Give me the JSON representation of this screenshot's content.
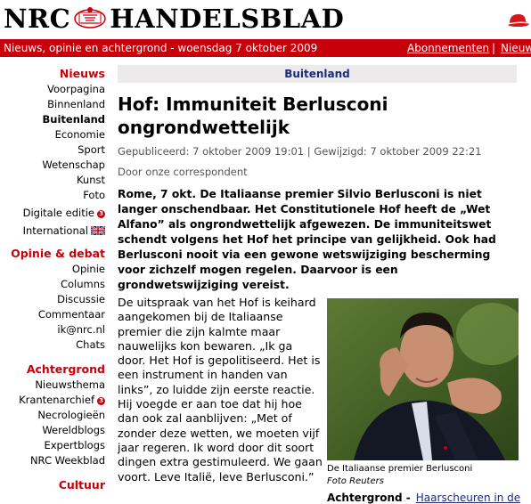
{
  "masthead": {
    "left": "NRC",
    "right": "HANDELSBLAD"
  },
  "topbar": {
    "tagline": "Nieuws, opinie en achtergrond - woensdag 7 oktober 2009",
    "subscribe": "Abonnementen",
    "more": "Nieuw"
  },
  "sidebar": {
    "nieuws_heading": "Nieuws",
    "nieuws_items": [
      "Voorpagina",
      "Binnenland",
      "Buitenland",
      "Economie",
      "Sport",
      "Wetenschap",
      "Kunst",
      "Foto"
    ],
    "digitale": "Digitale editie",
    "international": "International",
    "opinie_heading": "Opinie & debat",
    "opinie_items": [
      "Opinie",
      "Columns",
      "Discussie",
      "Commentaar",
      "ik@nrc.nl",
      "Chats"
    ],
    "achtergrond_heading": "Achtergrond",
    "achtergrond_items": [
      "Nieuwsthema",
      "Krantenarchief",
      "Necrologieën",
      "Wereldblogs",
      "Expertblogs",
      "NRC Weekblad"
    ],
    "cultuur_heading": "Cultuur",
    "badge": "3"
  },
  "article": {
    "section": "Buitenland",
    "title": "Hof: Immuniteit Berlusconi ongrondwettelijk",
    "meta": "Gepubliceerd: 7 oktober 2009 19:01 | Gewijzigd: 7 oktober 2009 22:21",
    "byline": "Door onze correspondent",
    "lead": "Rome, 7 okt. De Italiaanse premier Silvio Berlusconi is niet langer onschendbaar. Het Constitutionele Hof heeft de „Wet Alfano” als ongrondwettelijk afgewezen. De immuniteitswet schendt volgens het Hof het principe van gelijkheid. Ook had Berlusconi nooit via een gewone wetswijziging bescherming voor zichzelf mogen regelen. Daarvoor is een grondwetswijziging vereist.",
    "body": "De uitspraak van het Hof is keihard aangekomen bij de Italiaanse premier die zijn kalmte maar nauwelijks kon bewaren. „Ik ga door. Het Hof is gepolitiseerd. Het is een instrument in handen van links”, zo luidde zijn eerste reactie. Hij voegde er aan toe dat hij hoe dan ook zal aanblijven: „Met of zonder deze wetten, we moeten vijf jaar regeren. Ik word door dit soort dingen extra gestimuleerd. We gaan voort. Leve Italië, leve Berlusconi.”",
    "caption": "De Italiaanse premier Berlusconi",
    "credit": "Foto Reuters",
    "achtergrond": "Achtergrond -",
    "achtergrond_link": "Haarscheuren in de"
  }
}
